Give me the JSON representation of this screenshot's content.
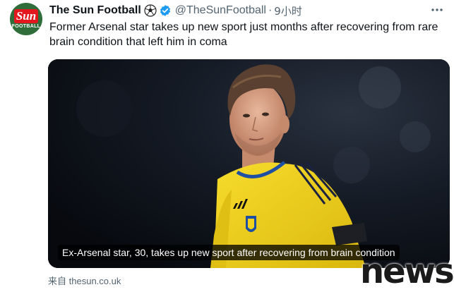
{
  "account": {
    "display_name": "The Sun Football",
    "emoji_icon": "soccer-ball-icon",
    "verified_icon": "verified-badge-icon",
    "handle": "@TheSunFootball",
    "separator": "·",
    "time": "9小时",
    "avatar": {
      "brand_text": "Sun",
      "sub_text": "FOOTBALL",
      "brand_color": "#e3181f",
      "background_color": "#2f6e3a"
    }
  },
  "tweet": {
    "text": "Former Arsenal star takes up new sport just months after recovering from rare brain condition that left him in coma"
  },
  "media": {
    "caption": "Ex-Arsenal star, 30, takes up new sport after recovering from brain condition",
    "jersey_color": "#f2d21a",
    "trim_color": "#1e4fa3"
  },
  "link": {
    "from_label": "来自",
    "domain": "thesun.co.uk"
  },
  "watermark": {
    "text": "news"
  },
  "colors": {
    "text_primary": "#0f1419",
    "text_secondary": "#536471",
    "verified_blue": "#1d9bf0"
  }
}
